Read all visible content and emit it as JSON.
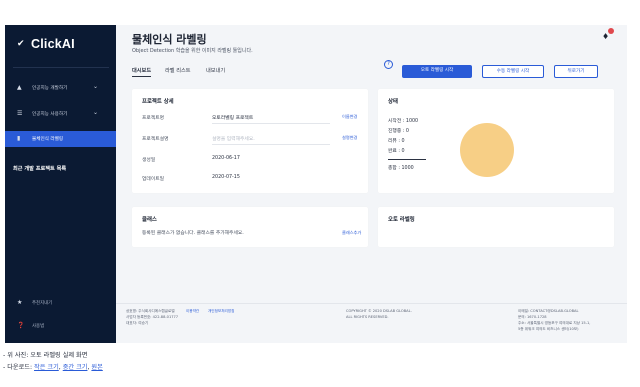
{
  "app": {
    "logo_text": "ClickAI"
  },
  "sidebar": {
    "items": [
      {
        "label": "인공지능 개발하기",
        "icon": "android-icon"
      },
      {
        "label": "인공지능 사용하기",
        "icon": "list-icon"
      },
      {
        "label": "물체인식 라벨링",
        "icon": "label-icon"
      }
    ],
    "recent_title": "최근 개발 프로젝트 목록",
    "bottom": [
      {
        "label": "추천지내기",
        "icon": "star-icon"
      },
      {
        "label": "사용법",
        "icon": "help-circle-icon"
      }
    ]
  },
  "header": {
    "title": "물체인식 라벨링",
    "subtitle": "Object Detection 학습을 위한 이미지 라벨링 툴입니다."
  },
  "tabs": [
    {
      "label": "대시보드"
    },
    {
      "label": "라벨 리스트"
    },
    {
      "label": "내보내기"
    }
  ],
  "actions": {
    "help": "?",
    "auto_label": "오토 라벨링 시작",
    "manual_label": "수동 라벨링 시작",
    "back": "뒤로가기"
  },
  "project": {
    "title": "프로젝트 상세",
    "rows": [
      {
        "label": "프로젝트명",
        "value": "오토라벨링 프로젝트",
        "action": "이름변경"
      },
      {
        "label": "프로젝트설명",
        "value": "설명을 입력해주세요.",
        "action": "설명변경"
      },
      {
        "label": "생성일",
        "value": "2020-06-17"
      },
      {
        "label": "업데이트일",
        "value": "2020-07-15"
      }
    ]
  },
  "status": {
    "title": "상태",
    "stats": [
      {
        "label": "시작전 : 1000"
      },
      {
        "label": "진행중 : 0"
      },
      {
        "label": "리뷰 : 0"
      },
      {
        "label": "완료 : 0"
      }
    ],
    "total": "총합 : 1000"
  },
  "classes": {
    "title": "클래스",
    "empty_text": "등록된 클래스가 없습니다. 클래스를 추가해주세요.",
    "action": "클래스추가"
  },
  "auto_label_card": {
    "title": "오토 라벨링"
  },
  "footer": {
    "company_lines": [
      "상호명: 주식회사디에스랩글로벌",
      "사업자 등록번호: 422-88-01777",
      "대표자: 여승기"
    ],
    "links": [
      "이용약관",
      "개인정보처리방침"
    ],
    "copyright_lines": [
      "COPYRIGHT © 2020 DSLAB GLOBAL.",
      "ALL RIGHTS RESERVED."
    ],
    "contact_lines": [
      "이메일: CONTACT@DSLAB.GLOBAL",
      "문의: 1670-1728",
      "주소: 서울특별시 영등포구 여의대로 지상 15-1,",
      "5층 위워크 여의도 비즈니스 센터(10모)"
    ]
  },
  "captions": {
    "line1": "- 위 사진: 오토 라벨링 실제 화면",
    "line2_prefix": "- 다운로드: ",
    "links": [
      "작은 크기",
      "중간 크기",
      "원본"
    ]
  },
  "colors": {
    "sidebar_bg": "#0b1a33",
    "accent": "#2a5bd7",
    "pie_fill": "#f7cf86",
    "notification": "#e0484d"
  }
}
